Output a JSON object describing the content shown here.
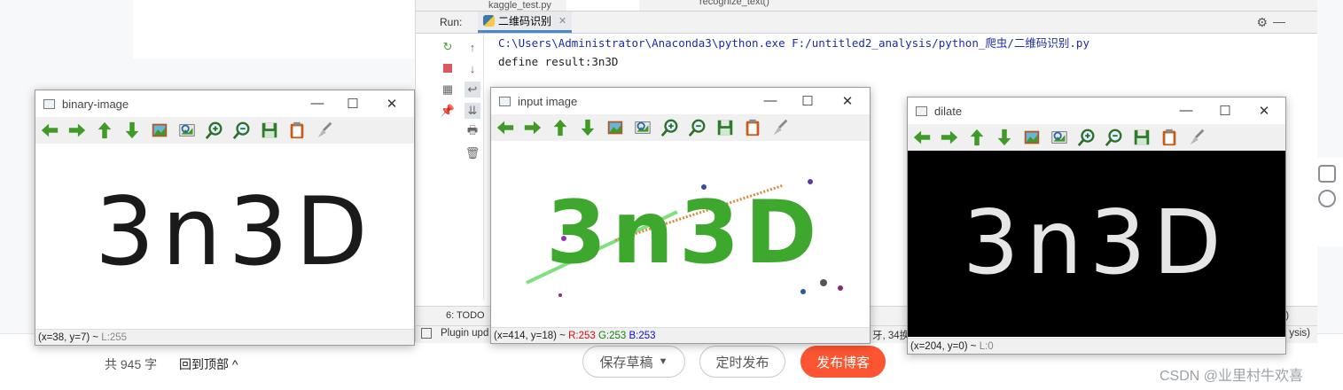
{
  "editor": {
    "word_count": "共 945 字",
    "back_to_top": "回到顶部",
    "buttons": {
      "save_draft": "保存草稿",
      "schedule": "定时发布",
      "publish": "发布博客"
    },
    "watermark": "CSDN @业里村牛欢喜",
    "accent_color": "#fc5531"
  },
  "ide": {
    "top_tab": "kaggle_test.py",
    "top_fn": "recognize_text()",
    "run_label": "Run:",
    "run_tab": "二维码识别",
    "console_lines": [
      "C:\\Users\\Administrator\\Anaconda3\\python.exe F:/untitled2_analysis/python_爬虫/二维码识别.py",
      "define result:3n3D"
    ],
    "status_tab": "6: TODO",
    "status_plugin": "Plugin upd",
    "status_right1": "牙, 34换行",
    "status_right2": "ysis)",
    "status_right3": "g)"
  },
  "windows": {
    "binary": {
      "title": "binary-image",
      "status_pos": "(x=38, y=7) ~",
      "status_val": "L:255",
      "text": "3n3D"
    },
    "input": {
      "title": "input image",
      "status_pos": "(x=414, y=18) ~",
      "r": "R:253",
      "g": "G:253",
      "b": "B:253",
      "text": "3n3D"
    },
    "dilate": {
      "title": "dilate",
      "status_pos": "(x=204, y=0) ~",
      "status_val": "L:0",
      "text": "3n3D"
    }
  },
  "toolbar_icons": [
    "arrow-left-icon",
    "arrow-right-icon",
    "arrow-up-icon",
    "arrow-down-icon",
    "image-icon",
    "zoom-fit-icon",
    "zoom-in-icon",
    "zoom-out-icon",
    "save-icon",
    "clipboard-icon",
    "brush-icon"
  ]
}
